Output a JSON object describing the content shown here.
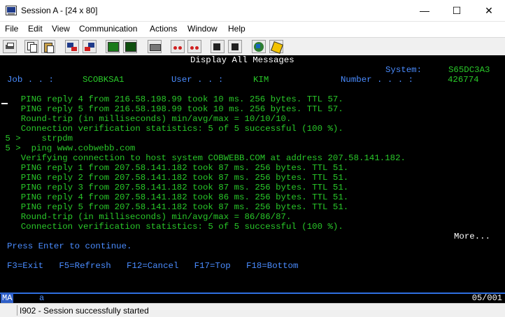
{
  "window": {
    "title": "Session A - [24 x 80]",
    "minimize_glyph": "—",
    "maximize_glyph": "☐",
    "close_glyph": "✕"
  },
  "menu": {
    "items": [
      "File",
      "Edit",
      "View",
      "Communication",
      "Actions",
      "Window",
      "Help"
    ]
  },
  "toolbar": {
    "buttons": [
      "print-screen-icon",
      "copy-icon",
      "paste-icon",
      "send-icon",
      "receive-icon",
      "display-icon",
      "keypad-icon",
      "record-macro-icon",
      "play-macro-icon",
      "stop-macro-icon",
      "playback-icon",
      "support-icon",
      "customize-icon"
    ]
  },
  "screen": {
    "header_title": "Display All Messages",
    "system_label": "System:",
    "system_value": "S65DC3A3",
    "job_label": "Job . . :",
    "job_value": "SCOBKSA1",
    "user_label": "User . . :",
    "user_value": "KIM",
    "number_label": "Number . . . :",
    "number_value": "426774",
    "messages": [
      "    PING reply 4 from 216.58.198.99 took 10 ms. 256 bytes. TTL 57.",
      "    PING reply 5 from 216.58.198.99 took 10 ms. 256 bytes. TTL 57.",
      "    Round-trip (in milliseconds) min/avg/max = 10/10/10.",
      "    Connection verification statistics: 5 of 5 successful (100 %).",
      " 5 >    strpdm",
      " 5 >  ping www.cobwebb.com",
      "    Verifying connection to host system COBWEBB.COM at address 207.58.141.182.",
      "    PING reply 1 from 207.58.141.182 took 87 ms. 256 bytes. TTL 51.",
      "    PING reply 2 from 207.58.141.182 took 87 ms. 256 bytes. TTL 51.",
      "    PING reply 3 from 207.58.141.182 took 87 ms. 256 bytes. TTL 51.",
      "    PING reply 4 from 207.58.141.182 took 86 ms. 256 bytes. TTL 51.",
      "    PING reply 5 from 207.58.141.182 took 87 ms. 256 bytes. TTL 51.",
      "    Round-trip (in milliseconds) min/avg/max = 86/86/87.",
      "    Connection verification statistics: 5 of 5 successful (100 %)."
    ],
    "more_label": "More...",
    "prompt": "Press Enter to continue.",
    "fkeys": "F3=Exit   F5=Refresh   F12=Cancel   F17=Top   F18=Bottom"
  },
  "oia": {
    "indicator": "MA",
    "mode": "a",
    "cursor_position": "05/001"
  },
  "statusbar": {
    "message": "I902 - Session successfully started"
  },
  "colors": {
    "screen_bg": "#000000",
    "text_green": "#29c829",
    "text_blue": "#4a8cff",
    "text_white": "#ffffff"
  }
}
